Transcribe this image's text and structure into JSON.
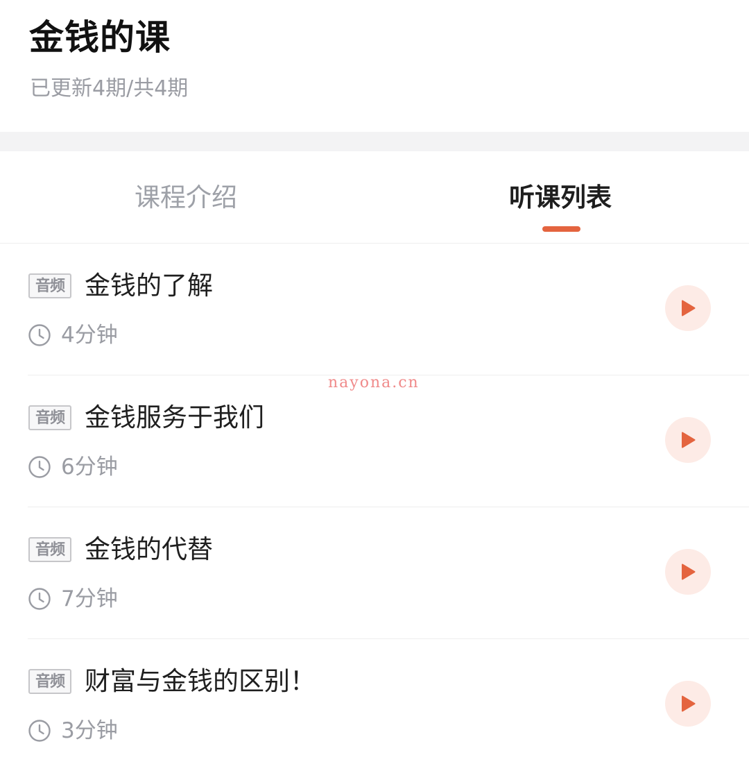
{
  "header": {
    "title": "金钱的课",
    "progress": "已更新4期/共4期"
  },
  "tabs": [
    {
      "label": "课程介绍",
      "active": false
    },
    {
      "label": "听课列表",
      "active": true
    }
  ],
  "lessons": [
    {
      "badge": "音频",
      "title": "金钱的了解",
      "duration": "4分钟"
    },
    {
      "badge": "音频",
      "title": "金钱服务于我们",
      "duration": "6分钟"
    },
    {
      "badge": "音频",
      "title": "金钱的代替",
      "duration": "7分钟"
    },
    {
      "badge": "音频",
      "title": "财富与金钱的区别！",
      "duration": "3分钟"
    }
  ],
  "icons": {
    "clock": "clock-icon",
    "play": "play-icon"
  },
  "colors": {
    "accent": "#e4643f",
    "play_bg": "#fdebe6",
    "muted_text": "#9a9ca3",
    "divider": "#eeeeee"
  },
  "watermark": "nayona.cn"
}
